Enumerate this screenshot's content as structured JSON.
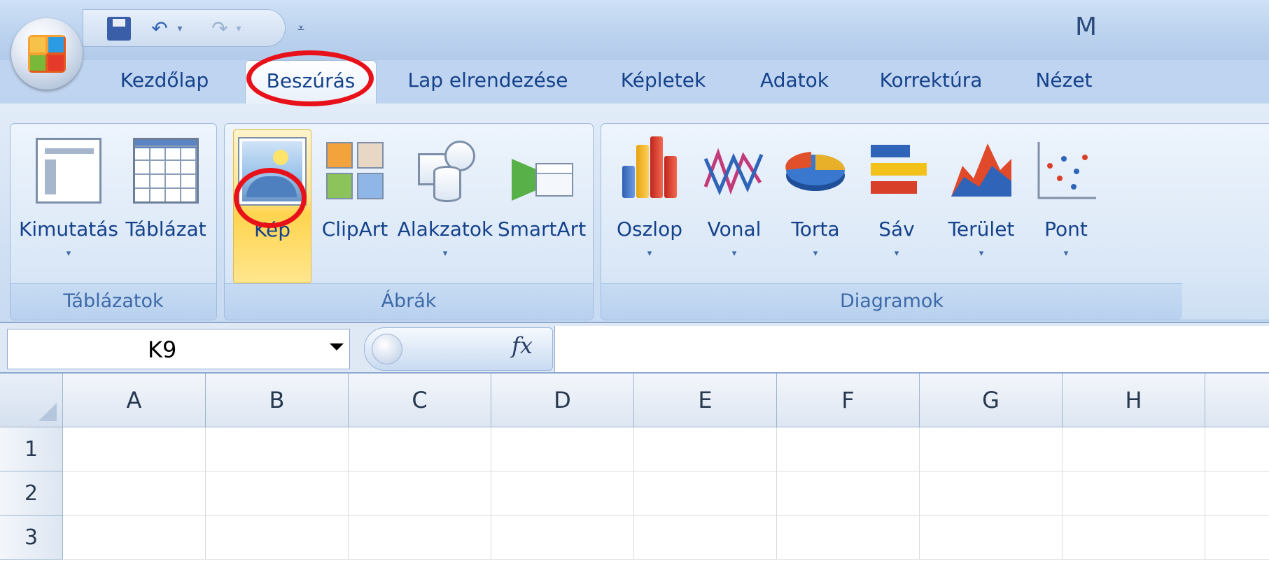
{
  "title_partial": "M",
  "quick_access": {
    "save_icon": "save-icon",
    "undo_icon": "undo-icon",
    "redo_icon": "redo-icon",
    "customize_icon": "customize-qat-icon"
  },
  "tabs": [
    {
      "label": "Kezdőlap",
      "active": false
    },
    {
      "label": "Beszúrás",
      "active": true
    },
    {
      "label": "Lap elrendezése",
      "active": false
    },
    {
      "label": "Képletek",
      "active": false
    },
    {
      "label": "Adatok",
      "active": false
    },
    {
      "label": "Korrektúra",
      "active": false
    },
    {
      "label": "Nézet",
      "active": false
    }
  ],
  "groups": {
    "tablazatok": {
      "label": "Táblázatok",
      "buttons": [
        {
          "label": "Kimutatás",
          "icon": "pivot-table-icon",
          "dropdown": true
        },
        {
          "label": "Táblázat",
          "icon": "table-icon",
          "dropdown": false
        }
      ]
    },
    "abrak": {
      "label": "Ábrák",
      "buttons": [
        {
          "label": "Kép",
          "icon": "picture-icon",
          "dropdown": false,
          "highlighted": true
        },
        {
          "label": "ClipArt",
          "icon": "clipart-icon",
          "dropdown": false
        },
        {
          "label": "Alakzatok",
          "icon": "shapes-icon",
          "dropdown": true
        },
        {
          "label": "SmartArt",
          "icon": "smartart-icon",
          "dropdown": false
        }
      ]
    },
    "diagramok": {
      "label": "Diagramok",
      "buttons": [
        {
          "label": "Oszlop",
          "icon": "column-chart-icon",
          "dropdown": true
        },
        {
          "label": "Vonal",
          "icon": "line-chart-icon",
          "dropdown": true
        },
        {
          "label": "Torta",
          "icon": "pie-chart-icon",
          "dropdown": true
        },
        {
          "label": "Sáv",
          "icon": "bar-chart-icon",
          "dropdown": true
        },
        {
          "label": "Terület",
          "icon": "area-chart-icon",
          "dropdown": true
        },
        {
          "label": "Pont",
          "icon": "scatter-chart-icon",
          "dropdown": true
        }
      ]
    }
  },
  "dropdown_glyph": "▾",
  "formula_bar": {
    "name_box": "K9",
    "fx_label": "fx",
    "formula": ""
  },
  "grid": {
    "columns": [
      "A",
      "B",
      "C",
      "D",
      "E",
      "F",
      "G",
      "H"
    ],
    "rows": [
      "1",
      "2",
      "3"
    ]
  },
  "annotations": {
    "highlight_color": "#e8111a",
    "circled": [
      "Beszúrás",
      "Kép"
    ]
  },
  "colors": {
    "accent": "#15428b",
    "ribbon_bg": "#d2e1f4",
    "highlight_button": "#ffd44e"
  }
}
